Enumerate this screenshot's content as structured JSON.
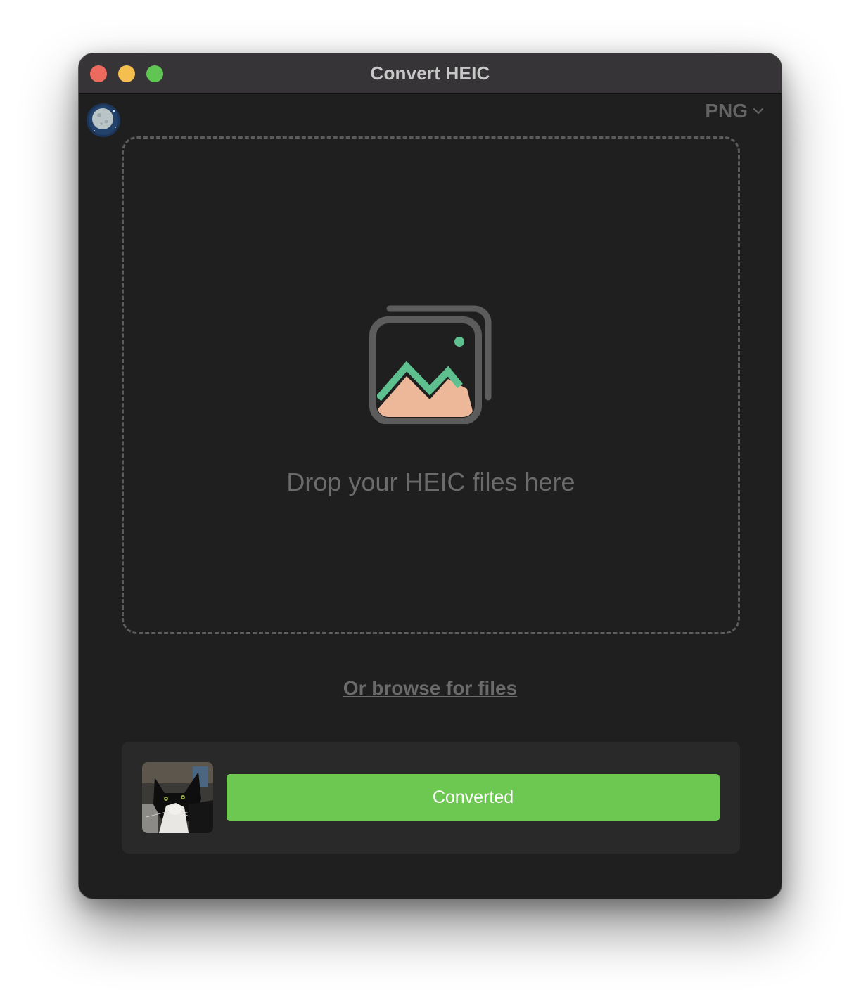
{
  "window": {
    "title": "Convert HEIC"
  },
  "toolbar": {
    "format_value": "PNG",
    "moon_icon": "moon-icon"
  },
  "dropzone": {
    "text": "Drop your HEIC files here",
    "icon": "image-stack-icon"
  },
  "browse": {
    "label": "Or browse for files"
  },
  "files": [
    {
      "thumbnail": "cat-photo",
      "status": "Converted"
    }
  ],
  "colors": {
    "status_green": "#6cc851",
    "accent_green": "#5fc08f",
    "mountain_peach": "#edb89a",
    "window_bg": "#1f1f1f"
  }
}
